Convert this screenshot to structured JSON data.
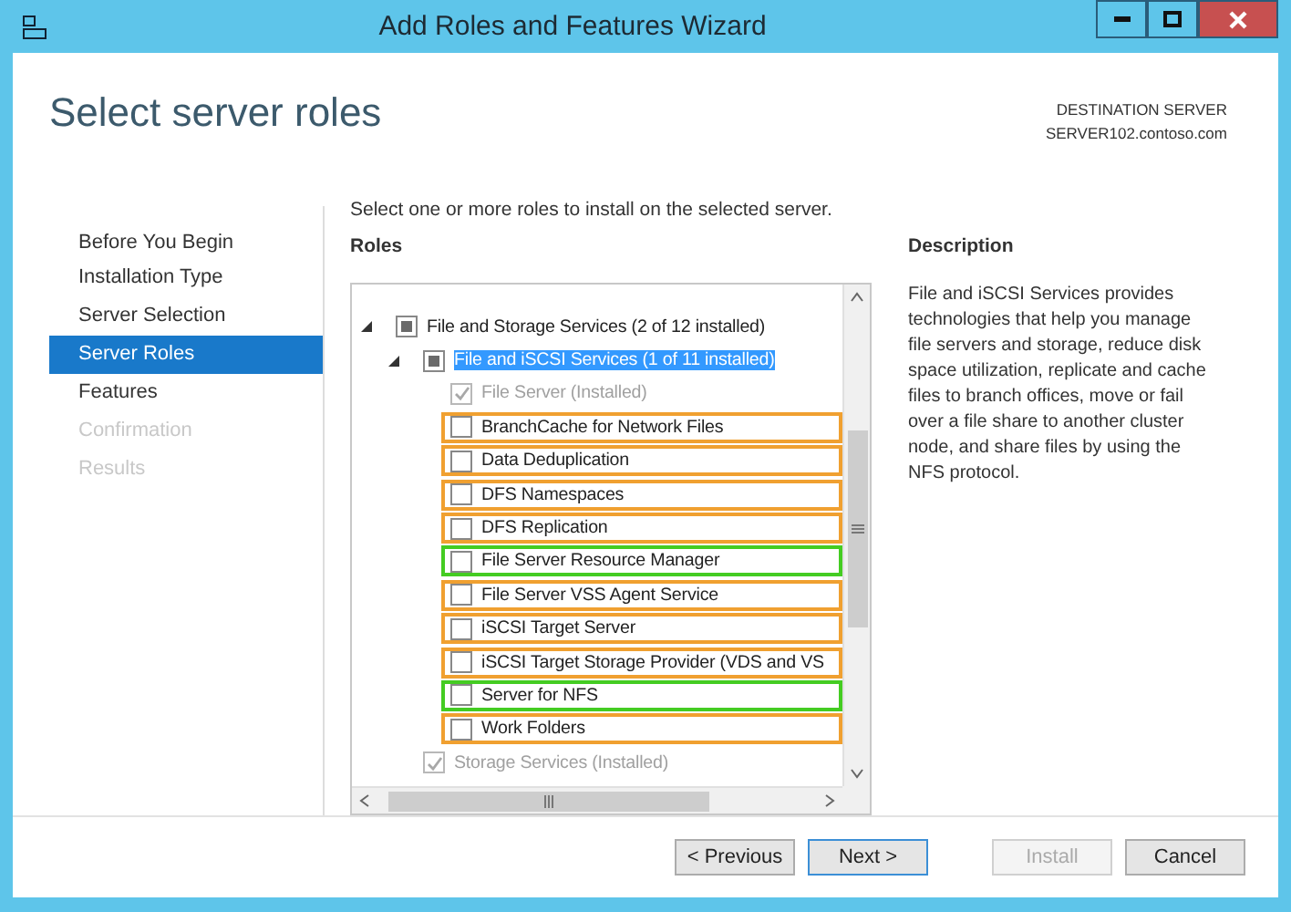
{
  "window": {
    "title": "Add Roles and Features Wizard"
  },
  "header": {
    "title": "Select server roles",
    "destination_label": "DESTINATION SERVER",
    "destination_server": "SERVER102.contoso.com"
  },
  "sidebar": {
    "items": [
      {
        "label": "Before You Begin",
        "selected": false,
        "disabled": false
      },
      {
        "label": "Installation Type",
        "selected": false,
        "disabled": false
      },
      {
        "label": "Server Selection",
        "selected": false,
        "disabled": false
      },
      {
        "label": "Server Roles",
        "selected": true,
        "disabled": false
      },
      {
        "label": "Features",
        "selected": false,
        "disabled": false
      },
      {
        "label": "Confirmation",
        "selected": false,
        "disabled": true
      },
      {
        "label": "Results",
        "selected": false,
        "disabled": true
      }
    ]
  },
  "instruction": "Select one or more roles to install on the selected server.",
  "roles": {
    "heading": "Roles",
    "items": [
      {
        "label": "File and Storage Services (2 of 12 installed)",
        "partial": true,
        "disabled": false,
        "selected": false,
        "expanded": true,
        "children": [
          {
            "label": "File and iSCSI Services (1 of 11 installed)",
            "partial": true,
            "disabled": false,
            "selected": true,
            "expanded": true,
            "children": [
              {
                "label": "File Server (Installed)",
                "checked": true,
                "disabled": true,
                "selected": false
              },
              {
                "label": "BranchCache for Network Files",
                "checked": false,
                "disabled": false,
                "selected": false,
                "color": "#f0a030"
              },
              {
                "label": "Data Deduplication",
                "checked": false,
                "disabled": false,
                "selected": false,
                "color": "#f0a030"
              },
              {
                "label": "DFS Namespaces",
                "checked": false,
                "disabled": false,
                "selected": false,
                "color": "#f0a030"
              },
              {
                "label": "DFS Replication",
                "checked": false,
                "disabled": false,
                "selected": false,
                "color": "#f0a030"
              },
              {
                "label": "File Server Resource Manager",
                "checked": false,
                "disabled": false,
                "selected": false,
                "color": "#44cc22"
              },
              {
                "label": "File Server VSS Agent Service",
                "checked": false,
                "disabled": false,
                "selected": false,
                "color": "#f0a030"
              },
              {
                "label": "iSCSI Target Server",
                "checked": false,
                "disabled": false,
                "selected": false,
                "color": "#f0a030"
              },
              {
                "label": "iSCSI Target Storage Provider (VDS and VS",
                "checked": false,
                "disabled": false,
                "selected": false,
                "color": "#f0a030"
              },
              {
                "label": "Server for NFS",
                "checked": false,
                "disabled": false,
                "selected": false,
                "color": "#44cc22"
              },
              {
                "label": "Work Folders",
                "checked": false,
                "disabled": false,
                "selected": false,
                "color": "#f0a030"
              }
            ]
          },
          {
            "label": "Storage Services (Installed)",
            "checked": true,
            "disabled": true,
            "selected": false
          }
        ]
      }
    ]
  },
  "description": {
    "heading": "Description",
    "text": "File and iSCSI Services provides technologies that help you manage file servers and storage, reduce disk space utilization, replicate and cache files to branch offices, move or fail over a file share to another cluster node, and share files by using the NFS protocol."
  },
  "buttons": [
    {
      "label": "< Previous",
      "disabled": false,
      "default": false
    },
    {
      "label": "Next >",
      "disabled": false,
      "default": true
    },
    {
      "label": "Install",
      "disabled": true,
      "default": false
    },
    {
      "label": "Cancel",
      "disabled": false,
      "default": false
    }
  ]
}
